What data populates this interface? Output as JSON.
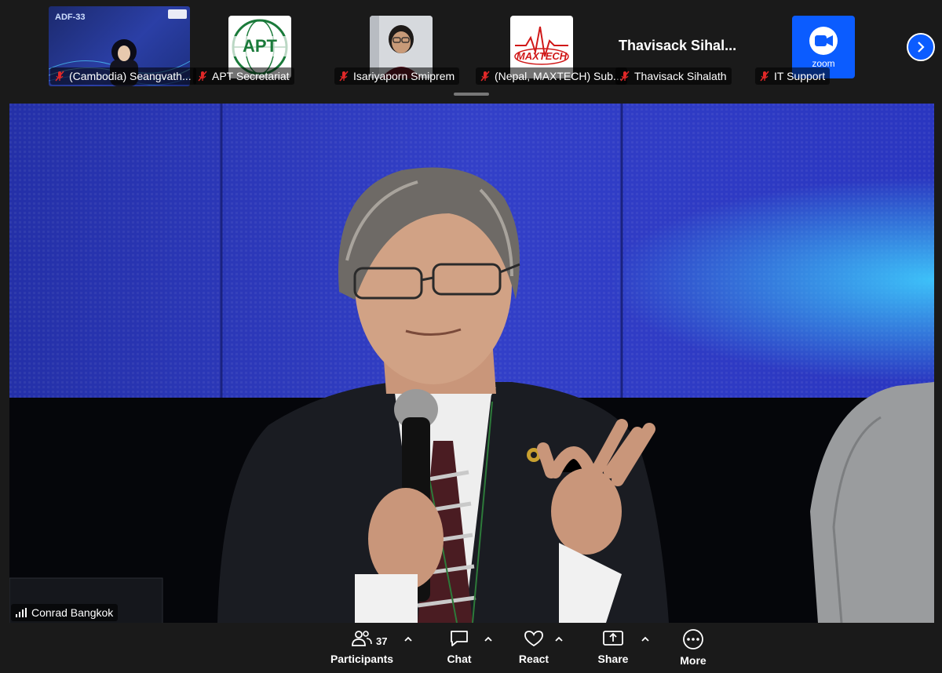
{
  "participants_strip": {
    "tiles": [
      {
        "name": "(Cambodia) Seangvath...",
        "thumb_type": "slide",
        "slide_title": "ADF-33",
        "muted": true
      },
      {
        "name": "APT Secretariat",
        "thumb_type": "logo",
        "logo_text": "APT",
        "muted": true
      },
      {
        "name": "Isariyaporn Smiprem",
        "thumb_type": "video",
        "muted": true
      },
      {
        "name": "(Nepal, MAXTECH) Sub...",
        "thumb_type": "logo",
        "logo_text": "MAXTECH",
        "muted": true
      },
      {
        "name": "Thavisack Sihalath",
        "thumb_type": "name",
        "display_name": "Thavisack  Sihal...",
        "muted": true
      },
      {
        "name": "IT Support",
        "thumb_type": "logo",
        "logo_text": "zoom",
        "muted": true
      }
    ]
  },
  "main_video": {
    "speaker_name": "Conrad Bangkok"
  },
  "toolbar": {
    "participants_label": "Participants",
    "participants_count": "37",
    "chat_label": "Chat",
    "react_label": "React",
    "share_label": "Share",
    "more_label": "More"
  },
  "colors": {
    "background": "#1a1a1a",
    "accent": "#0b5cff",
    "muted_icon": "#e02828",
    "stage_blue": "#2a36c0",
    "maxtech_red": "#d01818"
  }
}
